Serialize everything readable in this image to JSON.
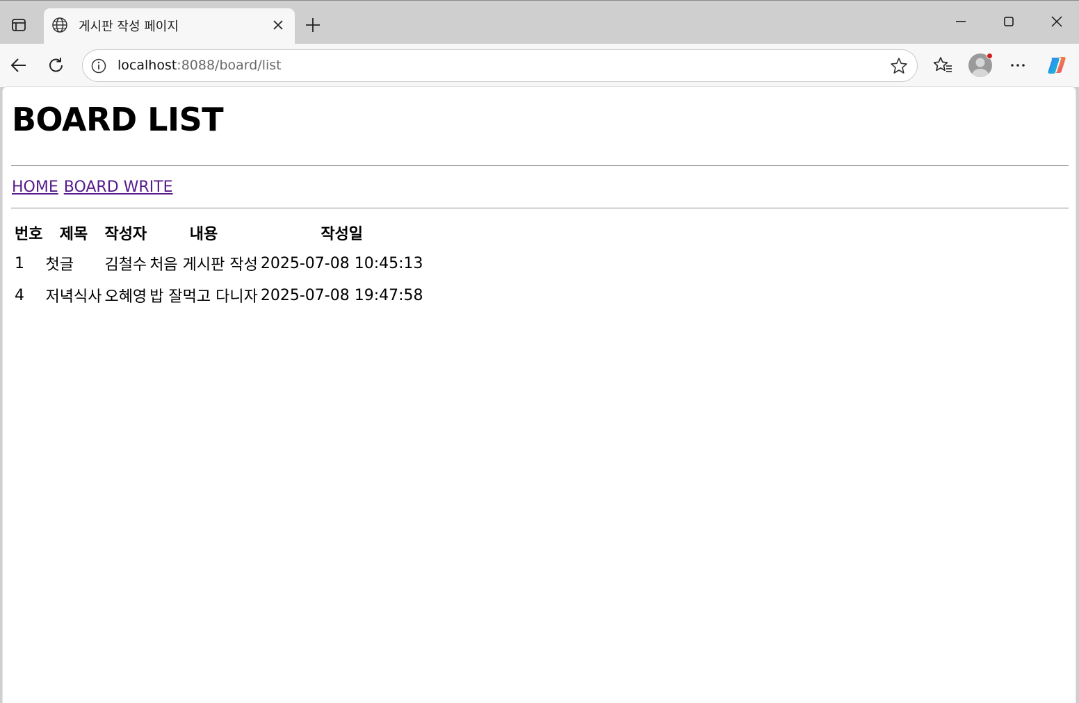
{
  "browser": {
    "tab": {
      "title": "게시판 작성 페이지"
    },
    "address": {
      "host": "localhost",
      "rest": ":8088/board/list"
    }
  },
  "page": {
    "title": "BOARD LIST",
    "nav": [
      {
        "label": "HOME"
      },
      {
        "label": "BOARD WRITE"
      }
    ],
    "table": {
      "headers": [
        "번호",
        "제목",
        "작성자",
        "내용",
        "작성일"
      ],
      "rows": [
        [
          "1",
          "첫글",
          "김철수",
          "처음 게시판 작성",
          "2025-07-08 10:45:13"
        ],
        [
          "4",
          "저녁식사",
          "오혜영",
          "밥 잘먹고 다니자",
          "2025-07-08 19:47:58"
        ]
      ]
    }
  },
  "colors": {
    "link_visited": "#551a8b",
    "notification_dot": "#d21b1b"
  },
  "icons": [
    "tab-actions-icon",
    "globe-icon",
    "close-icon",
    "plus-icon",
    "minimize-icon",
    "maximize-icon",
    "back-arrow-icon",
    "refresh-icon",
    "info-icon",
    "star-icon",
    "favorites-icon",
    "profile-icon",
    "more-icon",
    "copilot-icon"
  ]
}
